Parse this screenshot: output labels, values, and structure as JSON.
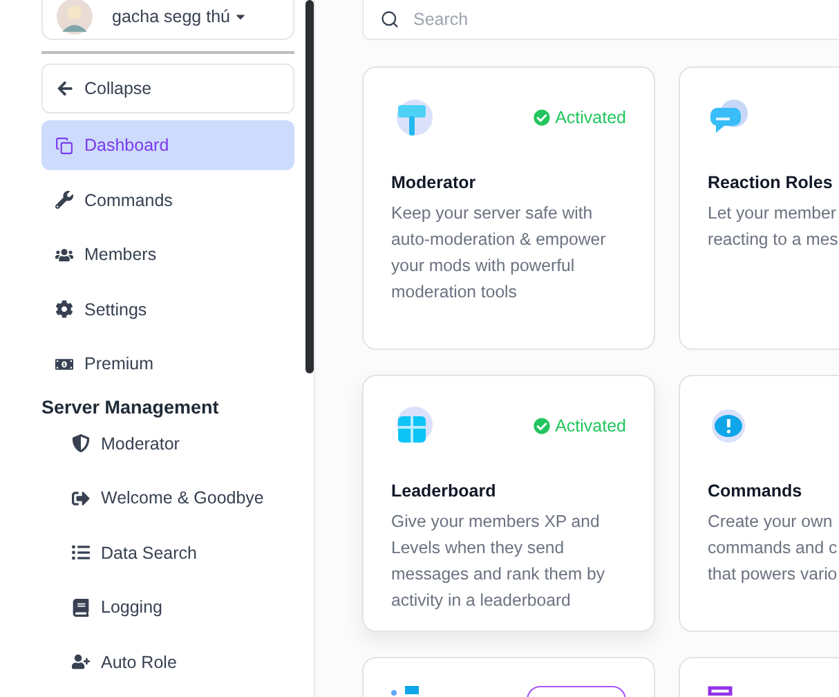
{
  "user": {
    "name": "gacha segg thú"
  },
  "sidebar": {
    "collapse": {
      "label": "Collapse"
    },
    "items": [
      {
        "label": "Dashboard",
        "selected": true
      },
      {
        "label": "Commands",
        "selected": false
      },
      {
        "label": "Members",
        "selected": false
      },
      {
        "label": "Settings",
        "selected": false
      },
      {
        "label": "Premium",
        "selected": false
      }
    ],
    "section": {
      "title": "Server Management",
      "items": [
        {
          "label": "Moderator",
          "selected": false
        },
        {
          "label": "Welcome & Goodbye",
          "selected": false
        },
        {
          "label": "Data Search",
          "selected": false
        },
        {
          "label": "Logging",
          "selected": false
        },
        {
          "label": "Auto Role",
          "selected": false
        }
      ]
    }
  },
  "search": {
    "placeholder": "Search"
  },
  "cards": [
    {
      "activated": true,
      "status": "Activated",
      "title": "Moderator",
      "lines": [
        "Keep your server safe with",
        "auto-moderation & empower",
        "your mods with powerful",
        "moderation tools"
      ]
    },
    {
      "activated": false,
      "title": "Reaction Roles",
      "lines": [
        "Let your member",
        "reacting to a mes"
      ]
    },
    {
      "activated": true,
      "status": "Activated",
      "title": "Leaderboard",
      "lines": [
        "Give your members XP and",
        "Levels when they send",
        "messages and rank them by",
        "activity in a leaderboard"
      ]
    },
    {
      "activated": false,
      "title": "Commands",
      "lines": [
        "Create your own",
        "commands and c",
        "that powers vario"
      ]
    },
    {
      "activated": false
    },
    {
      "activated": false
    }
  ]
}
